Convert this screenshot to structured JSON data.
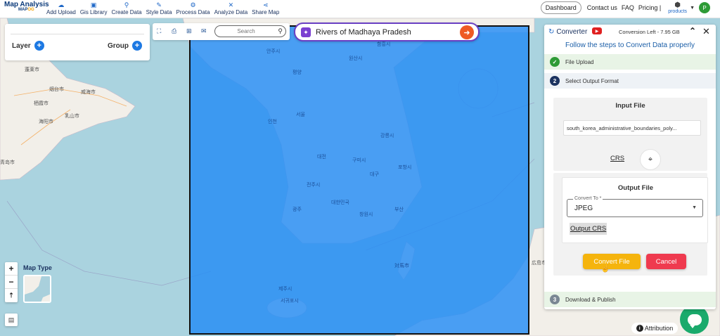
{
  "app": {
    "logo_title": "Map Analysis",
    "logo_sub_a": "MAP",
    "logo_sub_b": "OG"
  },
  "nav": {
    "items": [
      {
        "label": "Add Upload",
        "icon": "cloud-upload-icon"
      },
      {
        "label": "Gis Library",
        "icon": "library-icon"
      },
      {
        "label": "Create Data",
        "icon": "map-pin-icon"
      },
      {
        "label": "Style Data",
        "icon": "style-icon"
      },
      {
        "label": "Process Data",
        "icon": "process-icon"
      },
      {
        "label": "Analyze Data",
        "icon": "analyze-icon"
      },
      {
        "label": "Share Map",
        "icon": "share-icon"
      }
    ],
    "dashboard": "Dashboard",
    "contact": "Contact us",
    "faq": "FAQ",
    "pricing": "Pricing |",
    "products": "products",
    "avatar_letter": "P"
  },
  "layer_panel": {
    "layer_label": "Layer",
    "group_label": "Group"
  },
  "toolbar": {
    "search_placeholder": "Search"
  },
  "data_search": {
    "text": "Rivers of Madhaya Pradesh"
  },
  "map": {
    "map_type_label": "Map Type",
    "attribution": "Attribution",
    "labels": [
      "蓬莱市",
      "烟台市",
      "威海市",
      "栖霞市",
      "海阳市",
      "乳山市",
      "青岛市",
      "안주시",
      "평양",
      "원산시",
      "함흥시",
      "인천",
      "서울",
      "강릉시",
      "대전",
      "구미시",
      "대구",
      "포항시",
      "전주시",
      "광주",
      "창원시",
      "부산",
      "대한민국",
      "서귀포시",
      "제주시",
      "対馬市",
      "広島市"
    ]
  },
  "converter": {
    "title": "Converter",
    "conversion_left": "Conversion Left - 7.95 GB",
    "subtitle": "Follow the steps to Convert Data properly",
    "step1": "File Upload",
    "step2_num": "2",
    "step2": "Select Output Format",
    "step3_num": "3",
    "step3": "Download & Publish",
    "input_title": "Input File",
    "input_file": "south_korea_administrative_boundaries_poly...",
    "crs_label": "CRS",
    "output_title": "Output File",
    "convert_to_label": "Convert To *",
    "convert_to_value": "JPEG",
    "output_crs": "Output CRS",
    "convert_button": "Convert File",
    "cancel_button": "Cancel"
  },
  "colors": {
    "accent_blue": "#1d79e3",
    "brand_navy": "#1c3360",
    "convert_yellow": "#f5b40d",
    "cancel_red": "#ef3a4f",
    "search_orange": "#ee5a24",
    "overlay_blue": "#238cf5",
    "success_green": "#2e9b36"
  }
}
